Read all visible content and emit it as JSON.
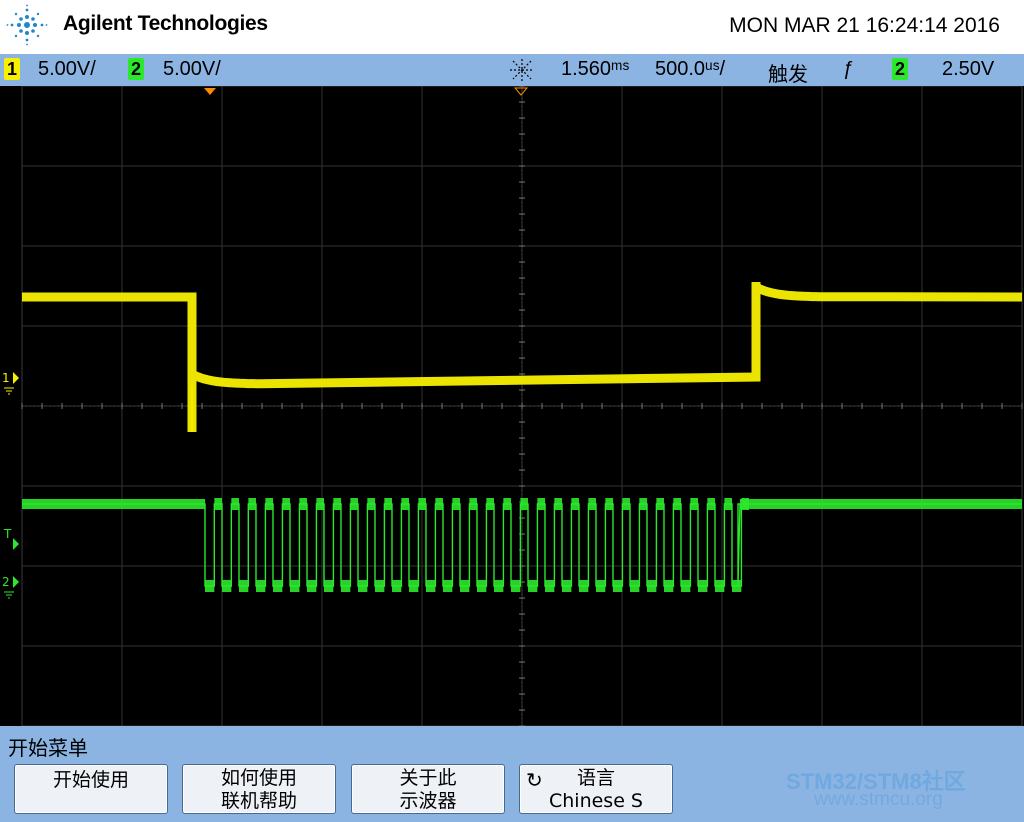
{
  "header": {
    "brand": "Agilent Technologies",
    "datetime": "MON MAR 21 16:24:14 2016"
  },
  "status": {
    "ch1_number": "1",
    "ch1_scale": "5.00V/",
    "ch2_number": "2",
    "ch2_scale": "5.00V/",
    "time_delay": "1.560ᵐˢ",
    "time_scale": "500.0ᵘˢ/",
    "trigger_label": "触发",
    "trigger_edge": "ƒ",
    "trigger_channel": "2",
    "trigger_level": "2.50V"
  },
  "markers": {
    "ch1_marker": "1",
    "trigger_marker": "T",
    "ch2_marker": "2"
  },
  "colors": {
    "ch1": "#f8f000",
    "ch2": "#2ce82c",
    "bar": "#8cb4e2",
    "trigger_delay": "#ff8a00"
  },
  "menu": {
    "title": "开始菜单",
    "softkeys": [
      {
        "lines": [
          "开始使用"
        ]
      },
      {
        "lines": [
          "如何使用",
          "联机帮助"
        ]
      },
      {
        "lines": [
          "关于此",
          "示波器"
        ]
      },
      {
        "icon": "rotate-icon",
        "lines": [
          "语言",
          "Chinese S"
        ]
      }
    ]
  },
  "watermark": {
    "main": "STM32/STM8社区",
    "sub": "www.stmcu.org"
  }
}
